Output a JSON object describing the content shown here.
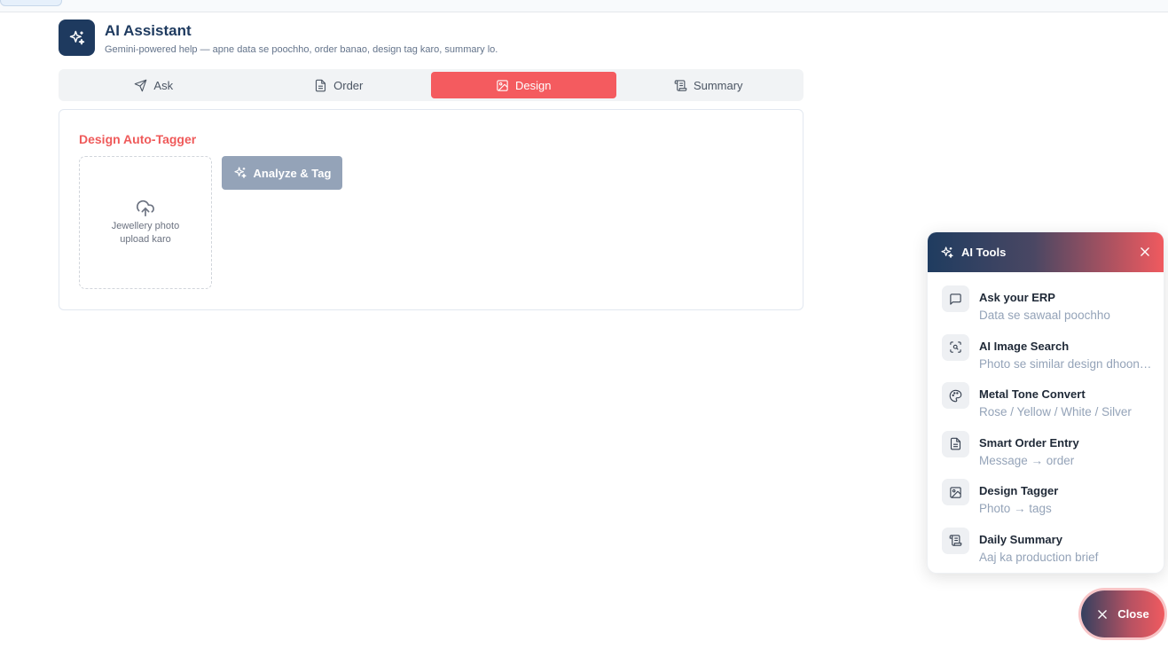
{
  "header": {
    "title": "AI Assistant",
    "subtitle": "Gemini-powered help — apne data se poochho, order banao, design tag karo, summary lo."
  },
  "tabs": [
    {
      "label": "Ask",
      "icon": "send-icon"
    },
    {
      "label": "Order",
      "icon": "document-icon"
    },
    {
      "label": "Design",
      "icon": "image-icon",
      "active": true
    },
    {
      "label": "Summary",
      "icon": "scroll-icon"
    }
  ],
  "design": {
    "title": "Design Auto-Tagger",
    "upload_text": "Jewellery photo upload karo",
    "analyze_label": "Analyze & Tag"
  },
  "panel": {
    "title": "AI Tools",
    "tools": [
      {
        "title": "Ask your ERP",
        "subtitle": "Data se sawaal poochho",
        "icon": "chat-icon"
      },
      {
        "title": "AI Image Search",
        "subtitle": "Photo se similar design dhoondho",
        "icon": "scan-search-icon"
      },
      {
        "title": "Metal Tone Convert",
        "subtitle": "Rose / Yellow / White / Silver",
        "icon": "palette-icon"
      },
      {
        "title": "Smart Order Entry",
        "subtitle": "Message → order",
        "icon": "document-icon"
      },
      {
        "title": "Design Tagger",
        "subtitle": "Photo → tags",
        "icon": "image-icon"
      },
      {
        "title": "Daily Summary",
        "subtitle": "Aaj ka production brief",
        "icon": "scroll-icon"
      }
    ]
  },
  "fab": {
    "label": "Close"
  },
  "colors": {
    "navy": "#1e3a5f",
    "accent": "#f45b5f",
    "disabled_button": "#94a3b8"
  }
}
